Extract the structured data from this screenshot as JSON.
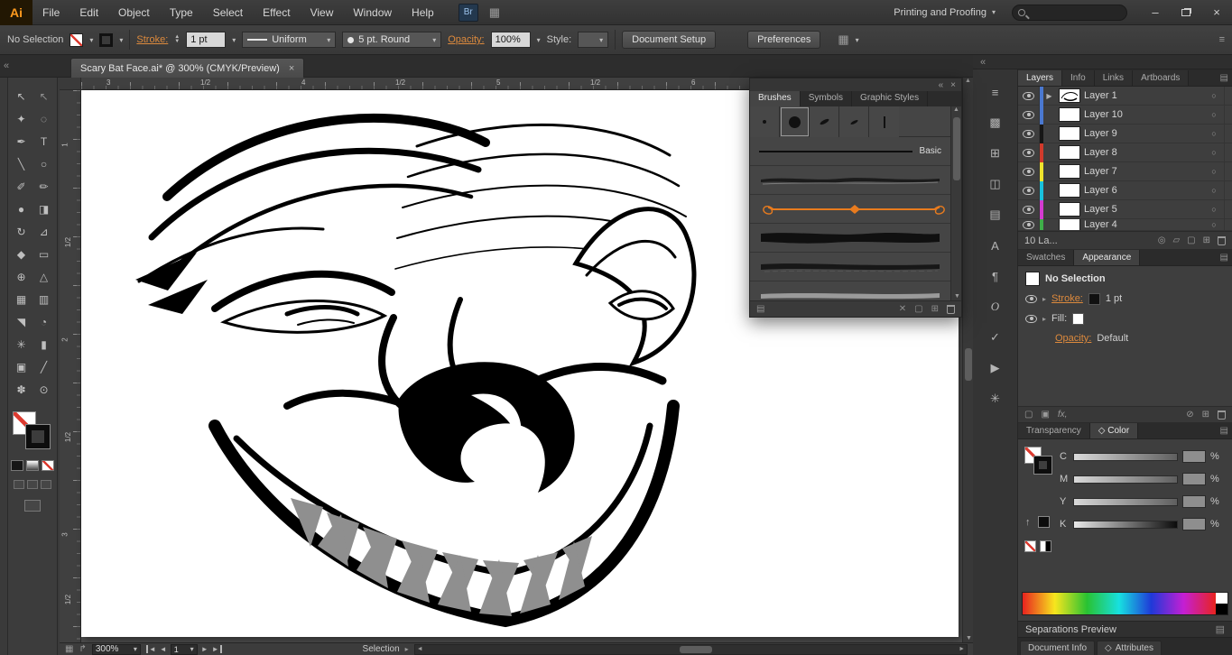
{
  "colors": {
    "accent_orange": "#dd8a3d",
    "selection_blue": "#4a78d0",
    "brush_orange": "#e87b1e",
    "teeth_gray": "#8f8f8f",
    "none_red": "#dd3b30"
  },
  "icons": {
    "dropdown": "▾",
    "up": "▲",
    "down": "▼",
    "left": "◄",
    "right": "►",
    "double_left": "«",
    "close": "×",
    "minimize": "–",
    "grid": "▦",
    "menu": "≡",
    "panel_menu": "▤",
    "books": "▤",
    "target": "○",
    "expand": "▶",
    "caret_right": "▸",
    "fx": "fx,",
    "circle_slash": "⊘",
    "new_square": "▢",
    "new_filled": "▣",
    "x": "✕",
    "plus_box": "⊞",
    "sub": "▱",
    "locate": "◎",
    "swap": "↑",
    "diamond": "◇",
    "export": "↱"
  },
  "menubar": {
    "logo": "Ai",
    "menus": [
      "File",
      "Edit",
      "Object",
      "Type",
      "Select",
      "Effect",
      "View",
      "Window",
      "Help"
    ],
    "bridge": "Br",
    "workspace": "Printing and Proofing"
  },
  "control_bar": {
    "selection_status": "No Selection",
    "stroke_label": "Stroke:",
    "stroke_weight": "1 pt",
    "width_profile": "Uniform",
    "brush_definition": "5 pt. Round",
    "opacity_label": "Opacity:",
    "opacity_value": "100%",
    "style_label": "Style:",
    "document_setup": "Document Setup",
    "preferences": "Preferences"
  },
  "document_tab": {
    "title": "Scary Bat Face.ai* @ 300% (CMYK/Preview)"
  },
  "rulers": {
    "top_labels": [
      "3",
      "1/2",
      "4",
      "1/2",
      "5",
      "1/2",
      "6"
    ],
    "left_labels": [
      "1",
      "1/2",
      "2",
      "1/2",
      "3",
      "1/2"
    ]
  },
  "toolbar": {
    "glyphs": [
      "↖",
      "↖",
      "✦",
      "◌",
      "✒",
      "T",
      "╲",
      "○",
      "✐",
      "✏",
      "●",
      "◨",
      "↻",
      "⊿",
      "◆",
      "▭",
      "⊕",
      "△",
      "▦",
      "▥",
      "◥",
      "◔",
      "✳",
      "▮",
      "▣",
      "╱",
      "✽",
      "⊙"
    ]
  },
  "dock": {
    "glyphs": [
      "≡",
      "▩",
      "⊞",
      "◫",
      "▤",
      "A",
      "¶",
      "O",
      "✓",
      "▶",
      "✳"
    ]
  },
  "brushes_panel": {
    "tabs": [
      "Brushes",
      "Symbols",
      "Graphic Styles"
    ],
    "active_tab": "Brushes",
    "basic_label": "Basic"
  },
  "layers_panel": {
    "tabs": [
      "Layers",
      "Info",
      "Links",
      "Artboards"
    ],
    "active_tab": "Layers",
    "layers": [
      {
        "name": "Layer 1",
        "color": "#4a78d0"
      },
      {
        "name": "Layer 10",
        "color": "#4a78d0"
      },
      {
        "name": "Layer 9",
        "color": "#161616"
      },
      {
        "name": "Layer 8",
        "color": "#d03a2b"
      },
      {
        "name": "Layer 7",
        "color": "#efe32c"
      },
      {
        "name": "Layer 6",
        "color": "#19c1dc"
      },
      {
        "name": "Layer 5",
        "color": "#d43bd0"
      },
      {
        "name": "Layer 4",
        "color": "#3fae49"
      }
    ],
    "status": "10 La..."
  },
  "appearance_panel": {
    "tabs": [
      "Swatches",
      "Appearance"
    ],
    "active_tab": "Appearance",
    "no_selection": "No Selection",
    "stroke_label": "Stroke:",
    "stroke_value": "1 pt",
    "fill_label": "Fill:",
    "opacity_label": "Opacity:",
    "opacity_value": "Default"
  },
  "color_panel": {
    "tabs": [
      "Transparency",
      "Color"
    ],
    "active_tab": "Color",
    "channels": [
      "C",
      "M",
      "Y",
      "K"
    ],
    "percent": "%"
  },
  "separations_panel": {
    "title": "Separations Preview"
  },
  "bottom_panel_tabs": [
    "Document Info",
    "Attributes"
  ],
  "status_bar": {
    "zoom": "300%",
    "artboard_number": "1",
    "status": "Selection"
  }
}
